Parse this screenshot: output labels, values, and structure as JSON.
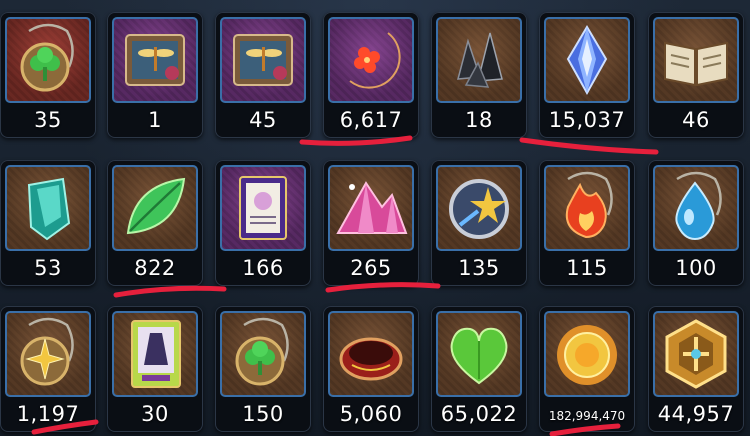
{
  "colors": {
    "frame_border": "#3a6fa8",
    "count_text": "#ffffff",
    "underline": "#e6203c"
  },
  "rows": [
    [
      {
        "icon": "green-clover-pendant-icon",
        "count": "35"
      },
      {
        "icon": "dragonfly-card-pack-icon",
        "count": "1"
      },
      {
        "icon": "dragonfly-card-pack-icon",
        "count": "45"
      },
      {
        "icon": "red-flower-crescent-pendant-icon",
        "count": "6,617"
      },
      {
        "icon": "black-crystal-shards-icon",
        "count": "18"
      },
      {
        "icon": "blue-crystal-gem-icon",
        "count": "15,037"
      },
      {
        "icon": "open-spell-book-icon",
        "count": "46"
      }
    ],
    [
      {
        "icon": "teal-crystal-block-icon",
        "count": "53"
      },
      {
        "icon": "green-leaf-icon",
        "count": "822"
      },
      {
        "icon": "purple-card-icon",
        "count": "166"
      },
      {
        "icon": "pink-crystal-mountain-icon",
        "count": "265"
      },
      {
        "icon": "shooting-star-badge-icon",
        "count": "135"
      },
      {
        "icon": "red-flame-pendant-icon",
        "count": "115"
      },
      {
        "icon": "blue-water-drop-pendant-icon",
        "count": "100"
      }
    ],
    [
      {
        "icon": "gold-star-pendant-icon",
        "count": "1,197"
      },
      {
        "icon": "green-dress-card-icon",
        "count": "30"
      },
      {
        "icon": "green-clover-pendant-icon",
        "count": "150"
      },
      {
        "icon": "red-ring-band-icon",
        "count": "5,060"
      },
      {
        "icon": "green-heart-icon",
        "count": "65,022"
      },
      {
        "icon": "golden-sun-medallion-icon",
        "count": "182,994,470"
      },
      {
        "icon": "gold-hexagon-emblem-icon",
        "count": "44,957"
      }
    ]
  ]
}
